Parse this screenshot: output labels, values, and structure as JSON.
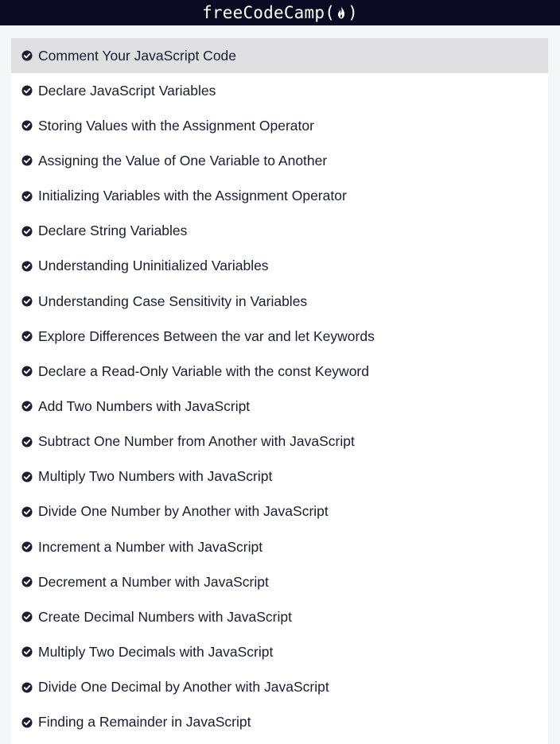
{
  "header": {
    "brand_name": "freeCodeCamp",
    "brand_open": "(",
    "brand_close": ")",
    "logo_icon": "flame-icon",
    "background_color": "#0a0a23"
  },
  "lessons": {
    "active_index": 0,
    "completed_icon": "check-circle-icon",
    "items": [
      {
        "label": "Comment Your JavaScript Code"
      },
      {
        "label": "Declare JavaScript Variables"
      },
      {
        "label": "Storing Values with the Assignment Operator"
      },
      {
        "label": "Assigning the Value of One Variable to Another"
      },
      {
        "label": "Initializing Variables with the Assignment Operator"
      },
      {
        "label": "Declare String Variables"
      },
      {
        "label": "Understanding Uninitialized Variables"
      },
      {
        "label": "Understanding Case Sensitivity in Variables"
      },
      {
        "label": "Explore Differences Between the var and let Keywords"
      },
      {
        "label": "Declare a Read-Only Variable with the const Keyword"
      },
      {
        "label": "Add Two Numbers with JavaScript"
      },
      {
        "label": "Subtract One Number from Another with JavaScript"
      },
      {
        "label": "Multiply Two Numbers with JavaScript"
      },
      {
        "label": "Divide One Number by Another with JavaScript"
      },
      {
        "label": "Increment a Number with JavaScript"
      },
      {
        "label": "Decrement a Number with JavaScript"
      },
      {
        "label": "Create Decimal Numbers with JavaScript"
      },
      {
        "label": "Multiply Two Decimals with JavaScript"
      },
      {
        "label": "Divide One Decimal by Another with JavaScript"
      },
      {
        "label": "Finding a Remainder in JavaScript"
      }
    ]
  }
}
